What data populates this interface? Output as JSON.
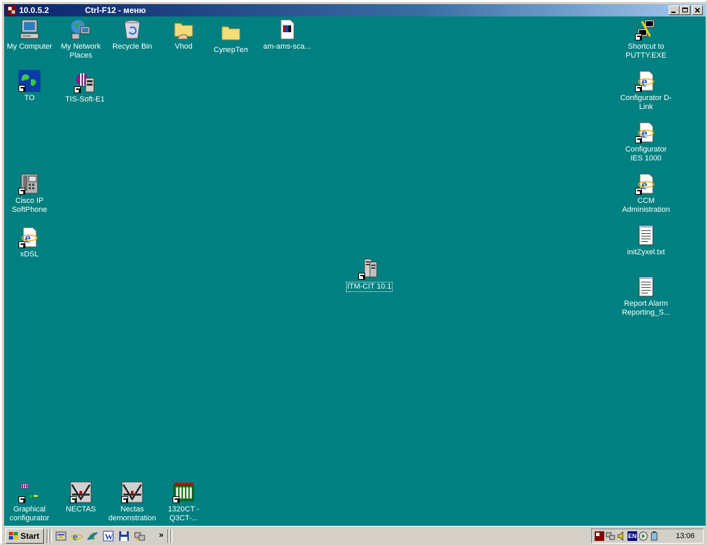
{
  "window": {
    "host": "10.0.5.2",
    "hint": "Ctrl-F12 - меню"
  },
  "desktop_icons": {
    "my_computer": "My Computer",
    "my_network_places": "My Network Places",
    "recycle_bin": "Recycle Bin",
    "vhod": "Vhod",
    "supertel": "СуперТел",
    "am_ams": "am-ams-sca...",
    "to": "TO",
    "tis_soft": "TIS-Soft-E1",
    "cisco_ip": "Cisco IP SoftPhone",
    "xdsl": "xDSL",
    "itm_cit": "ITM-CIT 10.1",
    "putty": "Shortcut to PUTTY.EXE",
    "cfg_dlink": "Configurator D-Link",
    "cfg_ies": "Configurator IES 1000",
    "ccm_admin": "CCM Administration",
    "init_zyxel": "initZyxel.txt",
    "report_alarm": "Report Alarm Reporting_S...",
    "graphical_cfg": "Graphical configurator",
    "nectas": "NECTAS",
    "nectas_demo": "Nectas demonstration",
    "ct_1320": "1320CT - Q3CT-..."
  },
  "taskbar": {
    "start_label": "Start",
    "overflow": "»",
    "lang": "EN",
    "clock": "13:06"
  },
  "colors": {
    "desktop": "#008080",
    "titlebar_start": "#0a246a",
    "titlebar_end": "#a6caf0"
  }
}
